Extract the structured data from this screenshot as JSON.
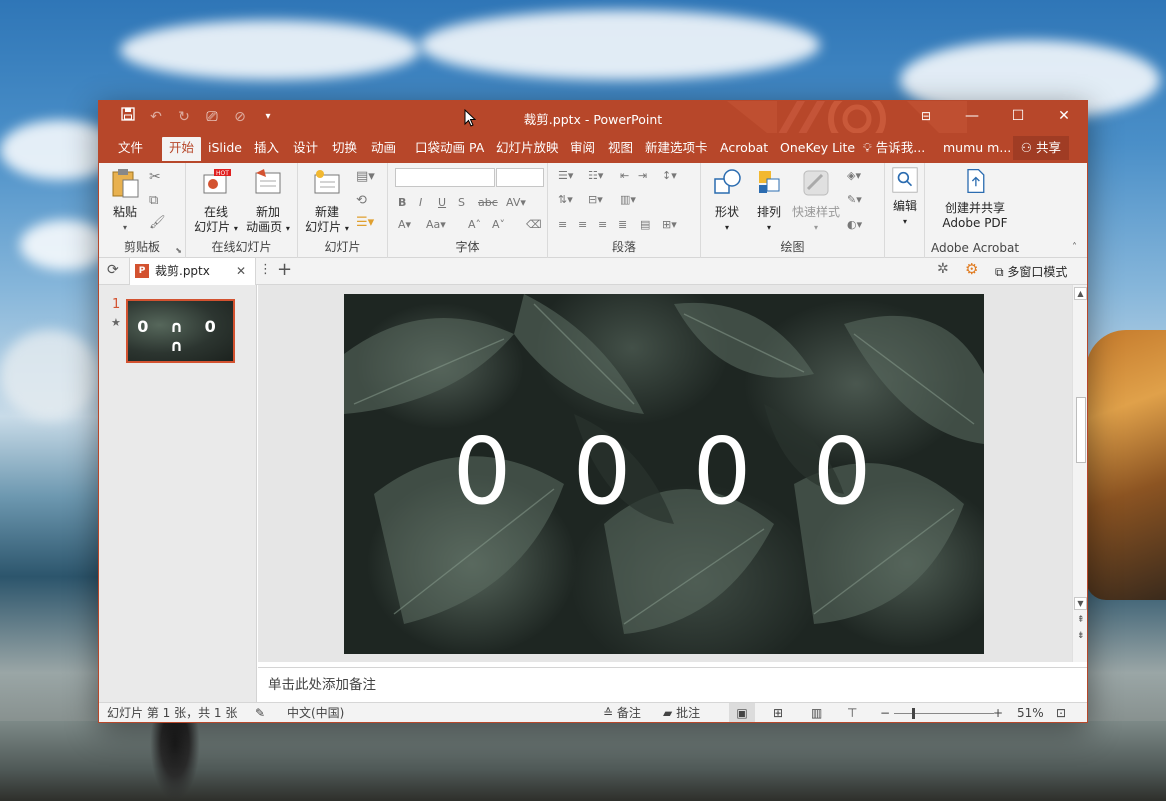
{
  "window": {
    "title": "裁剪.pptx - PowerPoint"
  },
  "qat": {
    "save_icon": "save-icon",
    "undo_icon": "undo-icon",
    "redo_icon": "redo-icon",
    "present_icon": "present-icon",
    "customize_icon": "customize-icon"
  },
  "ribbon_tabs": [
    "文件",
    "开始",
    "iSlide",
    "插入",
    "设计",
    "切换",
    "动画",
    "口袋动画 PA",
    "幻灯片放映",
    "审阅",
    "视图",
    "新建选项卡",
    "Acrobat",
    "OneKey Lite",
    "告诉我...",
    "mumu m..."
  ],
  "active_tab": "开始",
  "share_label": "共享",
  "ribbon": {
    "clipboard": {
      "paste": "粘贴",
      "label": "剪贴板"
    },
    "online": {
      "online_slides_1": "在线",
      "online_slides_2": "幻灯片",
      "new_anim_1": "新加",
      "new_anim_2": "动画页",
      "label": "在线幻灯片",
      "hot": "HOT"
    },
    "slides": {
      "new_slide_1": "新建",
      "new_slide_2": "幻灯片",
      "label": "幻灯片"
    },
    "font": {
      "label": "字体"
    },
    "paragraph": {
      "label": "段落"
    },
    "drawing": {
      "shapes": "形状",
      "arrange": "排列",
      "quick_styles": "快速样式",
      "label": "绘图"
    },
    "editing": {
      "edit": "编辑"
    },
    "acrobat": {
      "create_1": "创建并共享",
      "create_2": "Adobe PDF",
      "label": "Adobe Acrobat"
    }
  },
  "doc_tab": {
    "name": "裁剪.pptx"
  },
  "multi_window": "多窗口模式",
  "thumbnail": {
    "number": "1",
    "star": "★",
    "digits": "0 ∩ 0 ∩"
  },
  "slide": {
    "digits": [
      "0",
      "0",
      "0",
      "0"
    ]
  },
  "notes_placeholder": "单击此处添加备注",
  "status": {
    "slide_info": "幻灯片 第 1 张，共 1 张",
    "language": "中文(中国)",
    "notes": "备注",
    "comments": "批注",
    "zoom": "51%"
  }
}
